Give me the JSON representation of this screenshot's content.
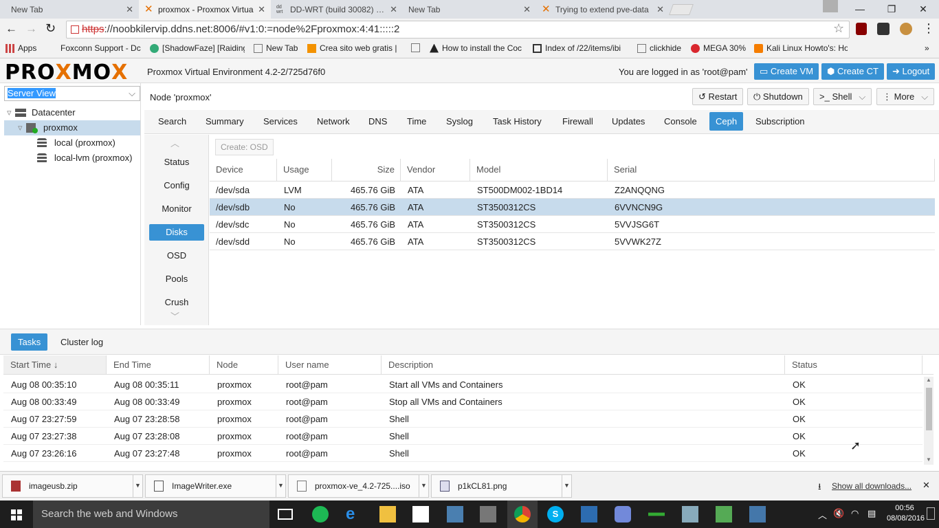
{
  "browser": {
    "tabs": [
      {
        "title": "New Tab",
        "active": false
      },
      {
        "title": "proxmox - Proxmox Virtua",
        "active": true
      },
      {
        "title": "DD-WRT (build 30082) - P",
        "active": false
      },
      {
        "title": "New Tab",
        "active": false
      },
      {
        "title": "Trying to extend pve-data",
        "active": false
      }
    ],
    "url_scheme": "https",
    "url_rest": "://noobkilervip.ddns.net:8006/#v1:0:=node%2Fproxmox:4:41:::::2",
    "bookmarks": [
      "Apps",
      "Foxconn Support - Dc",
      "[ShadowFaze] [Raiding",
      "New Tab",
      "Crea sito web gratis |",
      "",
      "How to install the Coc",
      "Index of /22/items/ibi",
      "clickhide",
      "MEGA 30%",
      "Kali Linux Howto's: Ho"
    ]
  },
  "proxmox": {
    "logo_a": "PRO",
    "logo_x": "X",
    "logo_b": "MO",
    "logo_x2": "X",
    "version": "Proxmox Virtual Environment 4.2-2/725d76f0",
    "logged_in": "You are logged in as 'root@pam'",
    "create_vm": "Create VM",
    "create_ct": "Create CT",
    "logout": "Logout",
    "view_select": "Server View",
    "tree": {
      "datacenter": "Datacenter",
      "node": "proxmox",
      "storage1": "local (proxmox)",
      "storage2": "local-lvm (proxmox)"
    },
    "node_title": "Node 'proxmox'",
    "restart": "Restart",
    "shutdown": "Shutdown",
    "shell": "Shell",
    "more": "More",
    "nav": [
      "Search",
      "Summary",
      "Services",
      "Network",
      "DNS",
      "Time",
      "Syslog",
      "Task History",
      "Firewall",
      "Updates",
      "Console",
      "Ceph",
      "Subscription"
    ],
    "nav_selected": "Ceph",
    "ceph_menu": [
      "Status",
      "Config",
      "Monitor",
      "Disks",
      "OSD",
      "Pools",
      "Crush"
    ],
    "ceph_selected": "Disks",
    "create_osd": "Create: OSD",
    "disk_columns": [
      "Device",
      "Usage",
      "Size",
      "Vendor",
      "Model",
      "Serial"
    ],
    "disks": [
      {
        "device": "/dev/sda",
        "usage": "LVM",
        "size": "465.76 GiB",
        "vendor": "ATA",
        "model": "ST500DM002-1BD14",
        "serial": "Z2ANQQNG",
        "selected": false
      },
      {
        "device": "/dev/sdb",
        "usage": "No",
        "size": "465.76 GiB",
        "vendor": "ATA",
        "model": "ST3500312CS",
        "serial": "6VVNCN9G",
        "selected": true
      },
      {
        "device": "/dev/sdc",
        "usage": "No",
        "size": "465.76 GiB",
        "vendor": "ATA",
        "model": "ST3500312CS",
        "serial": "5VVJSG6T",
        "selected": false
      },
      {
        "device": "/dev/sdd",
        "usage": "No",
        "size": "465.76 GiB",
        "vendor": "ATA",
        "model": "ST3500312CS",
        "serial": "5VVWK27Z",
        "selected": false
      }
    ],
    "tasks_tab": "Tasks",
    "cluster_log_tab": "Cluster log",
    "task_columns": [
      "Start Time ↓",
      "End Time",
      "Node",
      "User name",
      "Description",
      "Status"
    ],
    "tasks": [
      {
        "start": "Aug 08 00:35:10",
        "end": "Aug 08 00:35:11",
        "node": "proxmox",
        "user": "root@pam",
        "desc": "Start all VMs and Containers",
        "status": "OK"
      },
      {
        "start": "Aug 08 00:33:49",
        "end": "Aug 08 00:33:49",
        "node": "proxmox",
        "user": "root@pam",
        "desc": "Stop all VMs and Containers",
        "status": "OK"
      },
      {
        "start": "Aug 07 23:27:59",
        "end": "Aug 07 23:28:58",
        "node": "proxmox",
        "user": "root@pam",
        "desc": "Shell",
        "status": "OK"
      },
      {
        "start": "Aug 07 23:27:38",
        "end": "Aug 07 23:28:08",
        "node": "proxmox",
        "user": "root@pam",
        "desc": "Shell",
        "status": "OK"
      },
      {
        "start": "Aug 07 23:26:16",
        "end": "Aug 07 23:27:48",
        "node": "proxmox",
        "user": "root@pam",
        "desc": "Shell",
        "status": "OK"
      }
    ]
  },
  "downloads": {
    "items": [
      "imageusb.zip",
      "ImageWriter.exe",
      "proxmox-ve_4.2-725....iso",
      "p1kCL81.png"
    ],
    "show_all": "Show all downloads..."
  },
  "taskbar": {
    "search": "Search the web and Windows",
    "time": "00:56",
    "date": "08/08/2016"
  },
  "colors": {
    "accent": "#3892d4",
    "logo_orange": "#e57000",
    "selected_row": "#c7dbec"
  }
}
